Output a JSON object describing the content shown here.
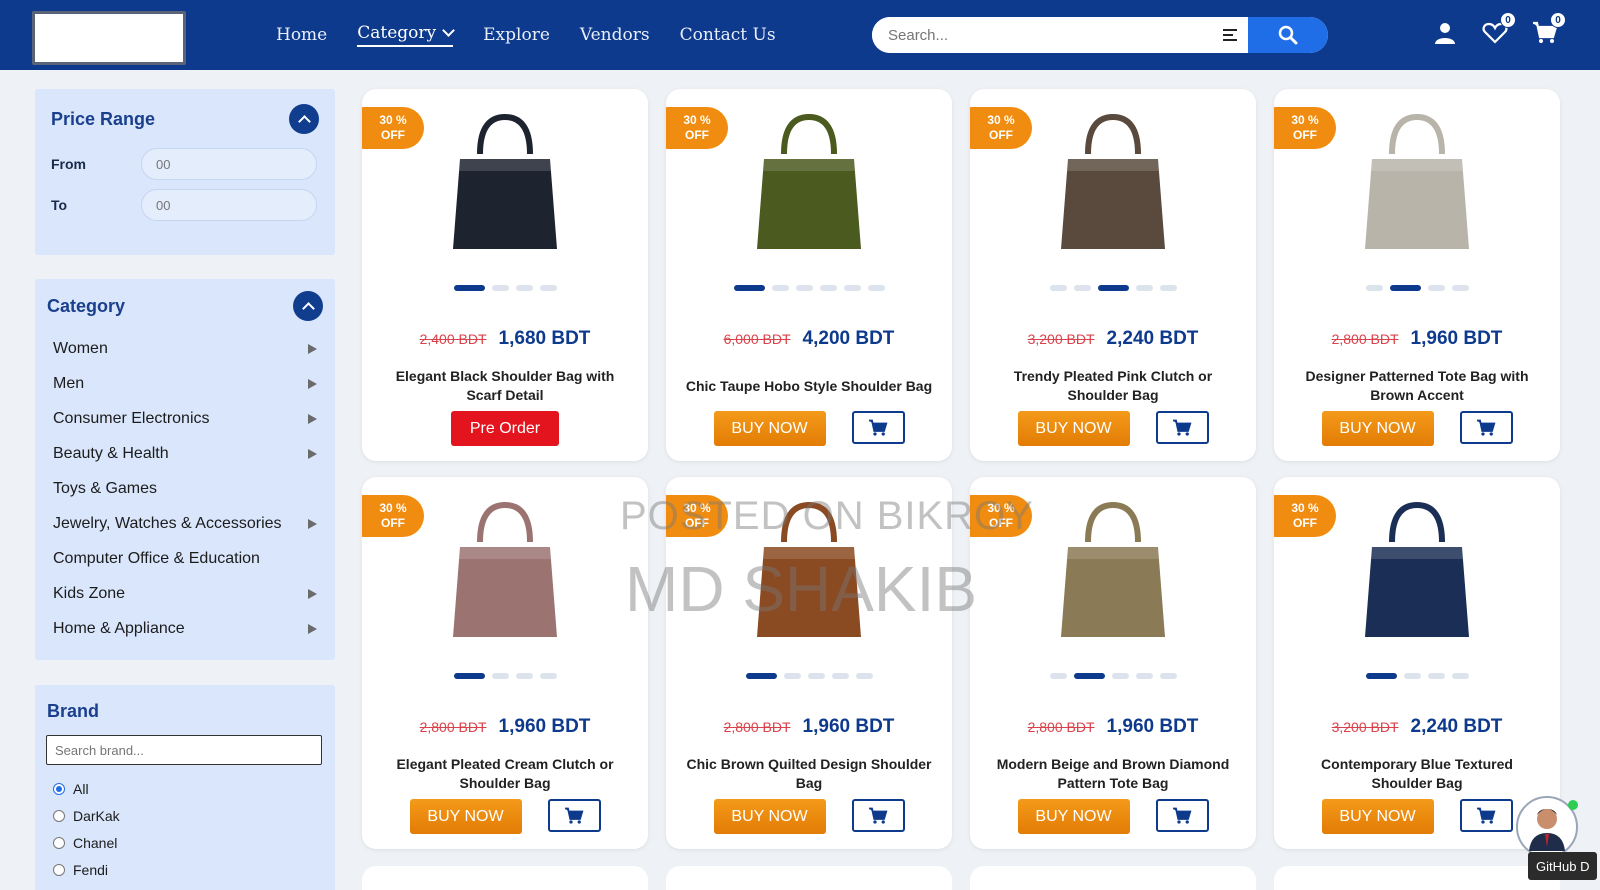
{
  "header": {
    "nav": [
      {
        "label": "Home"
      },
      {
        "label": "Category"
      },
      {
        "label": "Explore"
      },
      {
        "label": "Vendors"
      },
      {
        "label": "Contact Us"
      }
    ],
    "search_placeholder": "Search...",
    "wishlist_count": "0",
    "cart_count": "0"
  },
  "price_range": {
    "title": "Price Range",
    "from_label": "From",
    "to_label": "To",
    "from_placeholder": "00",
    "to_placeholder": "00"
  },
  "category": {
    "title": "Category",
    "items": [
      {
        "label": "Women",
        "has_sub": true
      },
      {
        "label": "Men",
        "has_sub": true
      },
      {
        "label": "Consumer Electronics",
        "has_sub": true
      },
      {
        "label": "Beauty & Health",
        "has_sub": true
      },
      {
        "label": "Toys & Games",
        "has_sub": false
      },
      {
        "label": "Jewelry, Watches & Accessories",
        "has_sub": true
      },
      {
        "label": "Computer Office & Education",
        "has_sub": false
      },
      {
        "label": "Kids Zone",
        "has_sub": true
      },
      {
        "label": "Home & Appliance",
        "has_sub": true
      }
    ]
  },
  "brand": {
    "title": "Brand",
    "search_placeholder": "Search brand...",
    "options": [
      {
        "label": "All",
        "checked": true
      },
      {
        "label": "DarKak",
        "checked": false
      },
      {
        "label": "Chanel",
        "checked": false
      },
      {
        "label": "Fendi",
        "checked": false
      }
    ]
  },
  "products": [
    {
      "discount": "30 %",
      "off": "OFF",
      "old_price": "2,400 BDT",
      "price": "1,680 BDT",
      "name": "Elegant Black Shoulder Bag with Scarf Detail",
      "action": "Pre Order",
      "preorder": true,
      "dots": 4,
      "active_dot": 0,
      "color": "#1e2330"
    },
    {
      "discount": "30 %",
      "off": "OFF",
      "old_price": "6,000 BDT",
      "price": "4,200 BDT",
      "name": "Chic Taupe Hobo Style Shoulder Bag",
      "action": "BUY NOW",
      "preorder": false,
      "dots": 6,
      "active_dot": 0,
      "color": "#4b5a1e"
    },
    {
      "discount": "30 %",
      "off": "OFF",
      "old_price": "3,200 BDT",
      "price": "2,240 BDT",
      "name": "Trendy Pleated Pink Clutch or Shoulder Bag",
      "action": "BUY NOW",
      "preorder": false,
      "dots": 5,
      "active_dot": 2,
      "color": "#5a4a3e"
    },
    {
      "discount": "30 %",
      "off": "OFF",
      "old_price": "2,800 BDT",
      "price": "1,960 BDT",
      "name": "Designer Patterned Tote Bag with Brown Accent",
      "action": "BUY NOW",
      "preorder": false,
      "dots": 4,
      "active_dot": 1,
      "color": "#b8b4aa"
    },
    {
      "discount": "30 %",
      "off": "OFF",
      "old_price": "2,800 BDT",
      "price": "1,960 BDT",
      "name": "Elegant Pleated Cream Clutch or Shoulder Bag",
      "action": "BUY NOW",
      "preorder": false,
      "dots": 4,
      "active_dot": 0,
      "color": "#9b7472"
    },
    {
      "discount": "30 %",
      "off": "OFF",
      "old_price": "2,800 BDT",
      "price": "1,960 BDT",
      "name": "Chic Brown Quilted Design Shoulder Bag",
      "action": "BUY NOW",
      "preorder": false,
      "dots": 5,
      "active_dot": 0,
      "color": "#8a4a22"
    },
    {
      "discount": "30 %",
      "off": "OFF",
      "old_price": "2,800 BDT",
      "price": "1,960 BDT",
      "name": "Modern Beige and Brown Diamond Pattern Tote Bag",
      "action": "BUY NOW",
      "preorder": false,
      "dots": 5,
      "active_dot": 1,
      "color": "#8a7a55"
    },
    {
      "discount": "30 %",
      "off": "OFF",
      "old_price": "3,200 BDT",
      "price": "2,240 BDT",
      "name": "Contemporary Blue Textured Shoulder Bag",
      "action": "BUY NOW",
      "preorder": false,
      "dots": 4,
      "active_dot": 0,
      "color": "#1b2e55"
    }
  ],
  "watermark": {
    "line1": "POSTED ON BIKROY",
    "line2": "MD SHAKIB"
  },
  "github_label": "GitHub D",
  "icons": {
    "search": "search-icon",
    "filter": "filter-lines-icon",
    "user": "user-icon",
    "wishlist": "heart-icon",
    "cart": "cart-icon"
  },
  "colors": {
    "brand": "#0d3a8c",
    "accent": "#f08c10",
    "preorder": "#e4141f",
    "sidebar": "#d9e6fb"
  }
}
